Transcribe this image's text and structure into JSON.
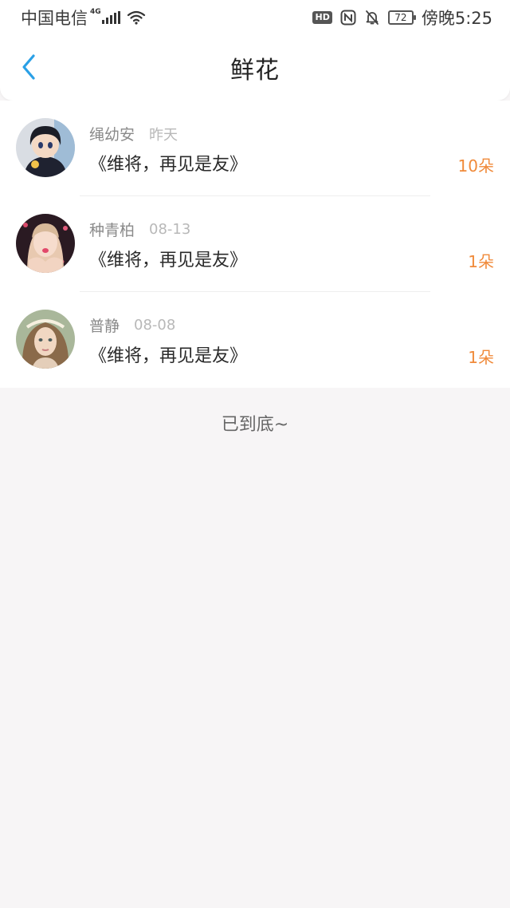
{
  "status_bar": {
    "carrier": "中国电信",
    "network": "4G",
    "hd": "HD",
    "battery": "72",
    "time": "傍晚5:25"
  },
  "nav": {
    "title": "鲜花",
    "back_icon": "chevron-left-icon",
    "accent_color": "#2aa0e6"
  },
  "list": {
    "items": [
      {
        "name": "绳幼安",
        "date": "昨天",
        "title": "《维将，再见是友》",
        "count": "10朵"
      },
      {
        "name": "种青柏",
        "date": "08-13",
        "title": "《维将，再见是友》",
        "count": "1朵"
      },
      {
        "name": "普静",
        "date": "08-08",
        "title": "《维将，再见是友》",
        "count": "1朵"
      }
    ]
  },
  "footer": {
    "end_text": "已到底~"
  },
  "colors": {
    "count": "#f08a3a",
    "background": "#f7f5f6"
  }
}
